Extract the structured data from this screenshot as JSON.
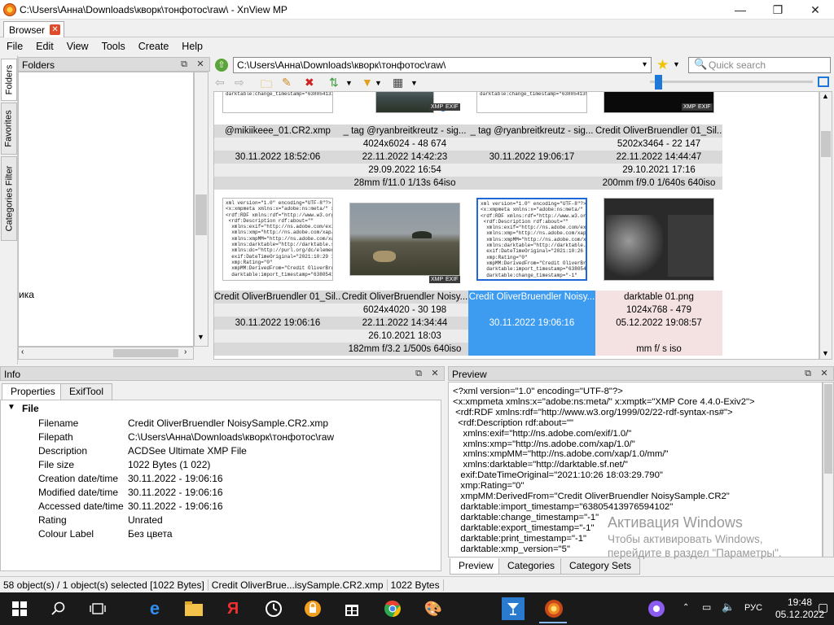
{
  "window": {
    "title": "C:\\Users\\Анна\\Downloads\\кворк\\тонфотос\\raw\\ - XnView MP"
  },
  "tabs": [
    {
      "label": "Browser"
    }
  ],
  "menu": [
    "File",
    "Edit",
    "View",
    "Tools",
    "Create",
    "Help"
  ],
  "side_tabs": [
    "Folders",
    "Favorites",
    "Categories Filter"
  ],
  "folders": {
    "title": "Folders",
    "partial_item": "ика"
  },
  "address": {
    "path": "C:\\Users\\Анна\\Downloads\\кворк\\тонфотос\\raw\\",
    "search_placeholder": "Quick search"
  },
  "thumbnails": [
    {
      "name": "@mikiikeee_01.CR2.xmp",
      "info1": "",
      "info2": "30.11.2022 18:52:06",
      "info3": "",
      "info4": "",
      "xml": "xmpRating=\"0\"\nxmpMM:DerivedFrom=\"@mikiikeee_CR2\"\ndarktable:import_timestamp=\"6380541238\ndarktable:change_timestamp=\"638054131"
    },
    {
      "name": "_ tag @ryanbreitkreutz - sig...",
      "info1": "4024x6024 - 48 674",
      "info2": "22.11.2022 14:42:23",
      "info3": "29.09.2022 16:54",
      "info4": "28mm f/11.0 1/13s 64iso"
    },
    {
      "name": "_ tag @ryanbreitkreutz - sig...",
      "info1": "",
      "info2": "30.11.2022 19:06:17",
      "info3": "",
      "info4": "",
      "xml": "xmpRating=\"0\"\nxmpMM:DerivedFrom=\"_ tag @ryanbreitkre\ndarktable:import_timestamp=\"6380541397\ndarktable:change_timestamp=\"6380541397"
    },
    {
      "name": "Credit OliverBruendler 01_Sil...",
      "info1": "5202x3464 - 22 147",
      "info2": "22.11.2022 14:44:47",
      "info3": "29.10.2021 17:16",
      "info4": "200mm f/9.0 1/640s 640iso"
    },
    {
      "name": "Credit OliverBruendler 01_Sil...",
      "info1": "",
      "info2": "30.11.2022 19:06:16",
      "info3": "",
      "info4": "",
      "xml": "xml version=\"1.0\" encoding=\"UTF-8\"?>\n<x:xmpmeta xmlns:x=\"adobe:ns:meta/\" xxmp\n<rdf:RDF xmlns:rdf=\"http://www.w3.org/199\n <rdf:Description rdf:about=\"\"\n  xmlns:exif=\"http://ns.adobe.com/exif/1.0/\"\n  xmlns:xmp=\"http://ns.adobe.com/xap/1.0/\"\n  xmlns:xmpMM=\"http://ns.adobe.com/xap/1.\n  xmlns:darktable=\"http://darktable.sf.net/\"\n  xmlns:dc=\"http://purl.org/dc/elements/1.1/\"\n  exif:DateTimeOriginal=\"2021:10:29 17:16:3\n  xmp:Rating=\"0\"\n  xmpMM:DerivedFrom=\"Credit OliverBruendl\n  darktable:import_timestamp=\"638054139762"
    },
    {
      "name": "Credit OliverBruendler Noisy...",
      "info1": "6024x4020 - 30 198",
      "info2": "22.11.2022 14:34:44",
      "info3": "26.10.2021 18:03",
      "info4": "182mm f/3.2 1/500s 640iso"
    },
    {
      "name": "Credit OliverBruendler Noisy...",
      "info1": "",
      "info2": "30.11.2022 19:06:16",
      "info3": "",
      "info4": "",
      "xml": "xml version=\"1.0\" encoding=\"UTF-8\"?>\n<x:xmpmeta xmlns:x=\"adobe:ns:meta/\" x:xmp\n<rdf:RDF xmlns:rdf=\"http://www.w3.org/1999\n <rdf:Description rdf:about=\"\"\n  xmlns:exif=\"http://ns.adobe.com/exif/1.0/\"\n  xmlns:xmp=\"http://ns.adobe.com/xap/1.0/\"\n  xmlns:xmpMM=\"http://ns.adobe.com/xap/1.0/\n  xmlns:darktable=\"http://darktable.sf.net/\"\n  exif:DateTimeOriginal=\"2021:10:26 18:03:2\n  xmp:Rating=\"0\"\n  xmpMM:DerivedFrom=\"Credit OliverBruendle\n  darktable:import_timestamp=\"638054139765\n  darktable:change_timestamp=\"-1\""
    },
    {
      "name": "darktable 01.png",
      "info1": "1024x768 - 479",
      "info2": "05.12.2022 19:08:57",
      "info3": "",
      "info4": "mm f/ s iso"
    }
  ],
  "badges": {
    "xmp": "XMP",
    "exif": "EXIF"
  },
  "info": {
    "title": "Info",
    "tabs": [
      "Properties",
      "ExifTool"
    ],
    "section": "File",
    "properties": [
      {
        "label": "Filename",
        "value": "Credit OliverBruendler NoisySample.CR2.xmp"
      },
      {
        "label": "Filepath",
        "value": "C:\\Users\\Анна\\Downloads\\кворк\\тонфотос\\raw"
      },
      {
        "label": "Description",
        "value": "ACDSee Ultimate XMP File"
      },
      {
        "label": "File size",
        "value": "1022 Bytes (1 022)"
      },
      {
        "label": "Creation date/time",
        "value": "30.11.2022 - 19:06:16"
      },
      {
        "label": "Modified date/time",
        "value": "30.11.2022 - 19:06:16"
      },
      {
        "label": "Accessed date/time",
        "value": "30.11.2022 - 19:06:16"
      },
      {
        "label": "Rating",
        "value": "Unrated"
      },
      {
        "label": "Colour Label",
        "value": "Без цвета"
      }
    ]
  },
  "preview": {
    "title": "Preview",
    "text": "<?xml version=\"1.0\" encoding=\"UTF-8\"?>\n<x:xmpmeta xmlns:x=\"adobe:ns:meta/\" x:xmptk=\"XMP Core 4.4.0-Exiv2\">\n <rdf:RDF xmlns:rdf=\"http://www.w3.org/1999/02/22-rdf-syntax-ns#\">\n  <rdf:Description rdf:about=\"\"\n    xmlns:exif=\"http://ns.adobe.com/exif/1.0/\"\n    xmlns:xmp=\"http://ns.adobe.com/xap/1.0/\"\n    xmlns:xmpMM=\"http://ns.adobe.com/xap/1.0/mm/\"\n    xmlns:darktable=\"http://darktable.sf.net/\"\n   exif:DateTimeOriginal=\"2021:10:26 18:03:29.790\"\n   xmp:Rating=\"0\"\n   xmpMM:DerivedFrom=\"Credit OliverBruendler NoisySample.CR2\"\n   darktable:import_timestamp=\"63805413976594102\"\n   darktable:change_timestamp=\"-1\"\n   darktable:export_timestamp=\"-1\"\n   darktable:print_timestamp=\"-1\"\n   darktable:xmp_version=\"5\"",
    "tabs": [
      "Preview",
      "Categories",
      "Category Sets"
    ]
  },
  "watermark": {
    "line1": "Активация Windows",
    "line2": "Чтобы активировать Windows,",
    "line3": "перейдите в раздел \"Параметры\"."
  },
  "status": {
    "count": "58 object(s) / 1 object(s) selected [1022 Bytes]",
    "file": "Credit OliverBrue...isySample.CR2.xmp",
    "size": "1022 Bytes"
  },
  "taskbar": {
    "lang": "РУС",
    "time": "19:48",
    "date": "05.12.2022"
  }
}
